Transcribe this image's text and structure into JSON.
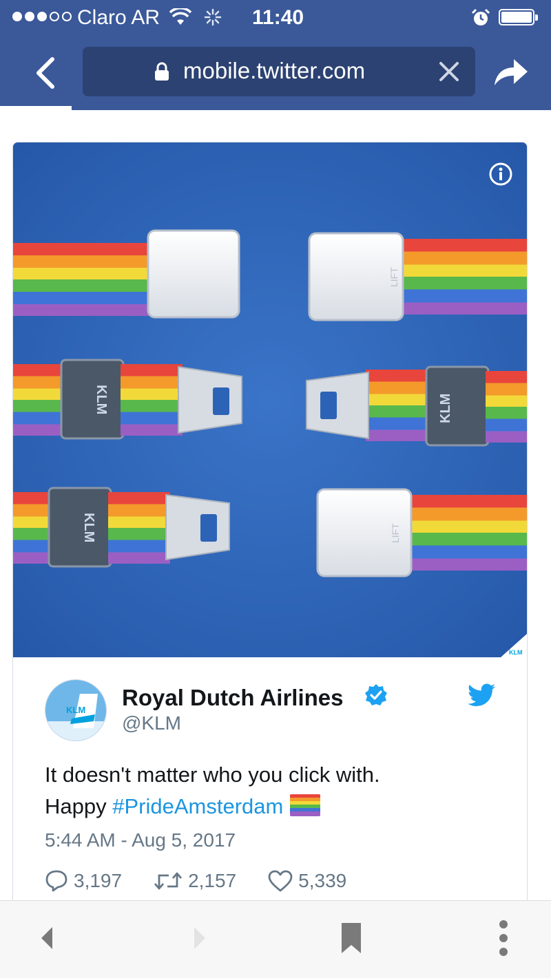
{
  "status_bar": {
    "carrier": "Claro AR",
    "time": "11:40",
    "signal_icon": "signal-dots-icon",
    "wifi_icon": "wifi-icon",
    "activity_icon": "activity-spinner-icon",
    "alarm_icon": "alarm-icon",
    "battery_icon": "battery-icon",
    "battery_level": 1.0
  },
  "browser": {
    "url": "mobile.twitter.com",
    "back_icon": "chevron-left-icon",
    "lock_icon": "lock-icon",
    "clear_icon": "close-icon",
    "share_icon": "share-arrow-icon",
    "bar_color": "#3b5999"
  },
  "tweet": {
    "display_name": "Royal Dutch Airlines",
    "handle": "@KLM",
    "text_line1": "It doesn't matter who you click with.",
    "text_line2_prefix": "Happy ",
    "hashtag": "#PrideAmsterdam",
    "timestamp": "5:44 AM - Aug 5, 2017",
    "replies": "3,197",
    "retweets": "2,157",
    "likes": "5,339",
    "avatar_logo": "KLM",
    "image_logo": "KLM",
    "belt_buckle_text": "LIFT",
    "accent_color": "#1b95e0",
    "image": {
      "description_icon": "info-icon",
      "subject": "rainbow-seatbelts-image"
    }
  },
  "toolbar": {
    "back_icon": "triangle-left-icon",
    "forward_icon": "triangle-right-icon",
    "bookmark_icon": "bookmark-icon",
    "menu_icon": "vertical-dots-icon"
  }
}
